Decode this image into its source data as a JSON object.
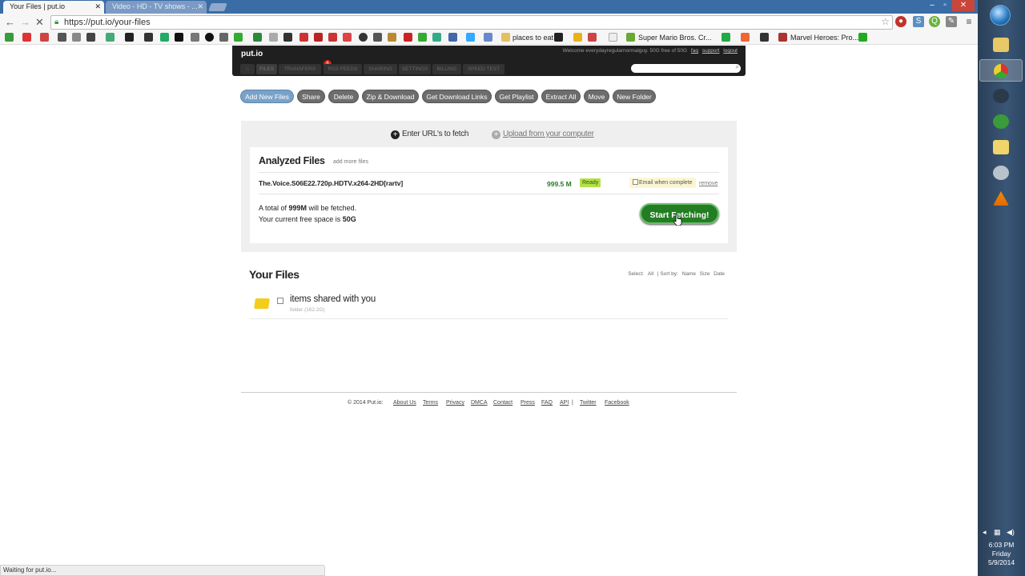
{
  "browser": {
    "tabs": [
      {
        "title": "Your Files | put.io",
        "active": true
      },
      {
        "title": "Video - HD - TV shows - ...",
        "active": false
      }
    ],
    "url": "https://put.io/your-files",
    "status_text": "Waiting for put.io...",
    "bookmarks": [
      {
        "label": "places to eat",
        "icon": "folder-icon"
      },
      {
        "label": "Super Mario Bros. Cr...",
        "icon": "game-icon"
      },
      {
        "label": "Marvel Heroes: Pro...",
        "icon": "marvel-icon"
      }
    ]
  },
  "site": {
    "logo": "put.io",
    "welcome_text": "Welcome everydayregularnormalguy. 50G free of 50G",
    "header_links": [
      "faq",
      "support",
      "logout"
    ],
    "nav_tabs": [
      "⌂",
      "FILES",
      "TRANSFERS",
      "RSS FEEDS",
      "SHARING",
      "SETTINGS",
      "BILLING",
      "SPEED TEST"
    ],
    "transfers_badge": "6",
    "actions": [
      "Add New Files",
      "Share",
      "Delete",
      "Zip & Download",
      "Get Download Links",
      "Get Playlist",
      "Extract All",
      "Move",
      "New Folder"
    ],
    "fetch": {
      "mode_url": "Enter URL's to fetch",
      "mode_upload": "Upload from your computer",
      "analyzed_title": "Analyzed Files",
      "add_more": "add more files",
      "file": {
        "name": "The.Voice.S06E22.720p.HDTV.x264-2HD[rartv]",
        "size": "999.5 M",
        "status": "Ready",
        "email_label": "Email when complete",
        "remove_label": "remove"
      },
      "total_prefix": "A total of ",
      "total_value": "999M",
      "total_suffix": " will be fetched.",
      "free_prefix": "Your current free space is ",
      "free_value": "50G",
      "start_button": "Start Fetching!"
    },
    "your_files": {
      "title": "Your Files",
      "select_label": "Select:",
      "select_all": "All",
      "sort_label": "| Sort by:",
      "sort_options": [
        "Name",
        "Size",
        "Date"
      ],
      "items": [
        {
          "name": "items shared with you",
          "meta": "folder (162.2G)"
        }
      ]
    },
    "footer": {
      "copyright": "© 2014 Put.io:",
      "links": [
        "About Us",
        "Terms",
        "Privacy",
        "DMCA",
        "Contact",
        "Press",
        "FAQ",
        "API",
        "|",
        "Twitter",
        "Facebook"
      ]
    }
  },
  "taskbar": {
    "time": "6:03 PM",
    "day": "Friday",
    "date": "5/9/2014",
    "apps": [
      "explorer-icon",
      "chrome-icon",
      "steam-icon",
      "globe-icon",
      "folder-icon",
      "disc-icon",
      "vlc-icon"
    ]
  },
  "colors": {
    "site_header": "#1f1f1f",
    "start_button": "#237d23",
    "ready_badge": "#b5e04a",
    "primary_action": "#7aa2c8"
  }
}
